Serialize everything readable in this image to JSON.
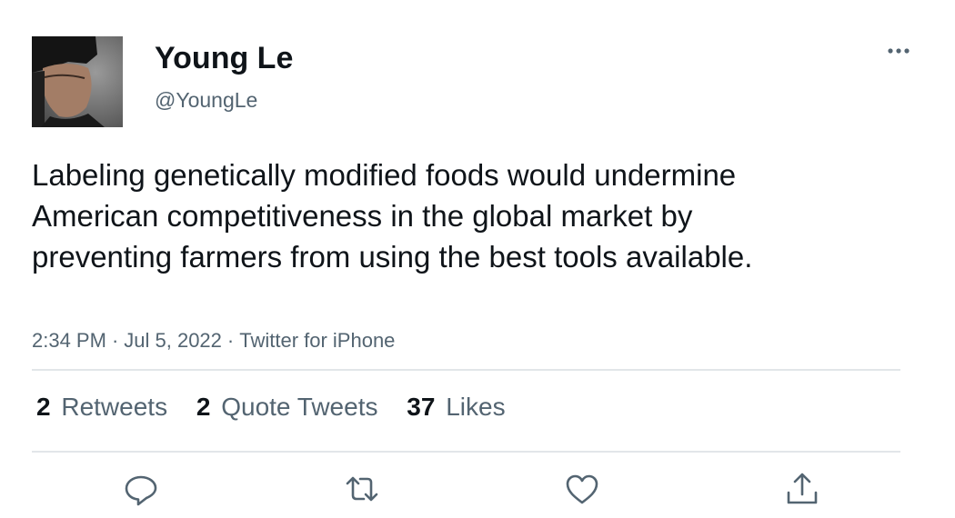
{
  "profile": {
    "name": "Young Le",
    "handle": "@YoungLe",
    "avatar": "profile-photo"
  },
  "tweet": {
    "text": "Labeling genetically modified foods would undermine American competitiveness in the global market by preventing farmers from using the best tools available.",
    "time": "2:34 PM",
    "date": "Jul 5, 2022",
    "source": "Twitter for iPhone",
    "separator": "·"
  },
  "stats": {
    "retweets_count": "2",
    "retweets_label": "Retweets",
    "quotes_count": "2",
    "quotes_label": "Quote Tweets",
    "likes_count": "37",
    "likes_label": "Likes"
  },
  "actions": {
    "reply": "reply-icon",
    "retweet": "retweet-icon",
    "like": "heart-icon",
    "share": "share-icon",
    "more": "more-icon"
  },
  "colors": {
    "text": "#0f1419",
    "secondary": "#536471",
    "divider": "#e2e6e9"
  }
}
